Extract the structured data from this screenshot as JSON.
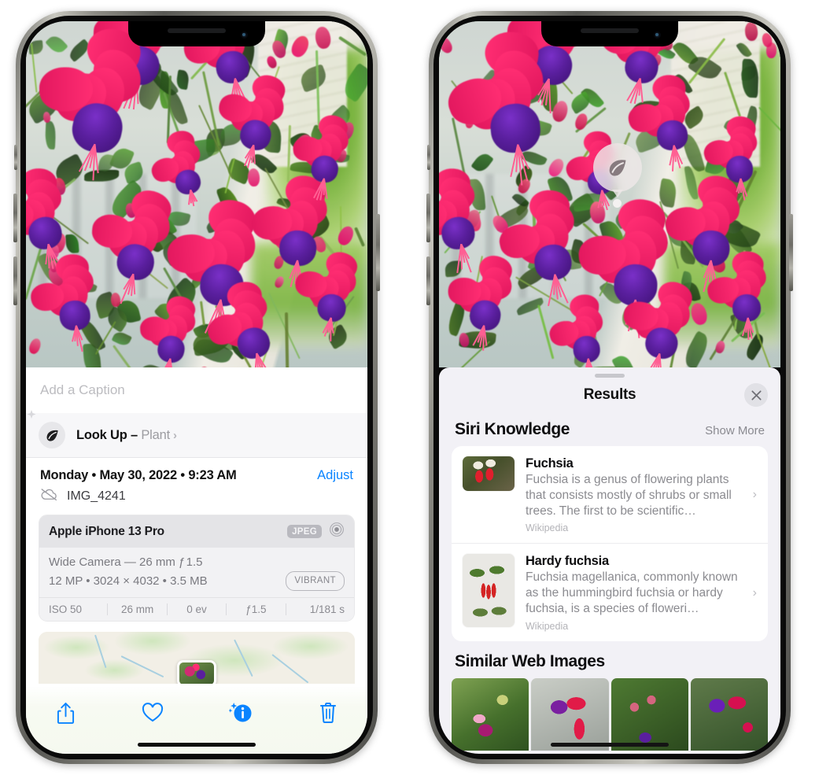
{
  "left_phone": {
    "name": "photos-detail-phone",
    "caption": {
      "placeholder": "Add a Caption",
      "value": ""
    },
    "lookup": {
      "label": "Look Up – ",
      "subject": "Plant",
      "chevron": "›",
      "icon": "leaf-icon"
    },
    "info": {
      "datetime": "Monday • May 30, 2022 • 9:23 AM",
      "adjust_label": "Adjust",
      "filename": "IMG_4241",
      "cloud_icon": "icloud-slash-icon"
    },
    "exif": {
      "device": "Apple iPhone 13 Pro",
      "format_badge": "JPEG",
      "aperture_icon": "aperture-icon",
      "lens_line": "Wide Camera — 26 mm ƒ 1.5",
      "size_line": "12 MP • 3024 × 4032 • 3.5 MB",
      "style_badge": "VIBRANT",
      "settings": [
        "ISO 50",
        "26 mm",
        "0 ev",
        "ƒ1.5",
        "1/181 s"
      ]
    },
    "map": {
      "name": "location-map-preview",
      "pin": "photo-thumbnail-pin"
    },
    "toolbar": [
      {
        "name": "share-button",
        "icon": "share-icon"
      },
      {
        "name": "favorite-button",
        "icon": "heart-icon"
      },
      {
        "name": "info-button",
        "icon": "info-sparkles-icon",
        "active": true
      },
      {
        "name": "delete-button",
        "icon": "trash-icon"
      }
    ]
  },
  "right_phone": {
    "name": "visual-lookup-results-phone",
    "badge": {
      "name": "visual-lookup-badge",
      "icon": "leaf-icon"
    },
    "sheet": {
      "title": "Results",
      "close_label": "✕",
      "grabber": "sheet-grabber"
    },
    "siri_knowledge": {
      "title": "Siri Knowledge",
      "action": "Show More",
      "items": [
        {
          "title": "Fuchsia",
          "description": "Fuchsia is a genus of flowering plants that consists mostly of shrubs or small trees. The first to be scientific…",
          "source": "Wikipedia",
          "chevron": "›"
        },
        {
          "title": "Hardy fuchsia",
          "description": "Fuchsia magellanica, commonly known as the hummingbird fuchsia or hardy fuchsia, is a species of floweri…",
          "source": "Wikipedia",
          "chevron": "›"
        }
      ]
    },
    "similar_web_images": {
      "title": "Similar Web Images",
      "count": 4
    }
  },
  "colors": {
    "accent_blue": "#0a84ff",
    "sheet_bg": "#f2f1f6",
    "card_bg": "#ffffff",
    "secondary_text": "#8b8b90"
  }
}
